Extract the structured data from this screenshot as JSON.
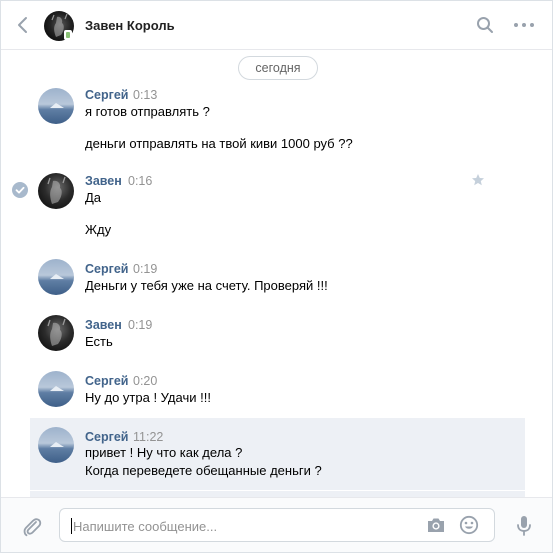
{
  "header": {
    "title": "Завен Король"
  },
  "date_divider": "сегодня",
  "messages": [
    {
      "author": "Сергей",
      "time": "0:13",
      "lines": [
        "я готов отправлять ?",
        "деньги отправлять на твой киви 1000 руб ??"
      ]
    },
    {
      "author": "Завен",
      "time": "0:16",
      "lines": [
        "Да",
        "Жду"
      ]
    },
    {
      "author": "Сергей",
      "time": "0:19",
      "lines": [
        "Деньги у тебя уже на счету. Проверяй !!!"
      ]
    },
    {
      "author": "Завен",
      "time": "0:19",
      "lines": [
        "Есть"
      ]
    },
    {
      "author": "Сергей",
      "time": "0:20",
      "lines": [
        "Ну до утра ! Удачи !!!"
      ]
    },
    {
      "author": "Сергей",
      "time": "11:22",
      "lines": [
        "привет ! Ну что как дела ?",
        "Когда переведете обещанные деньги ?"
      ]
    }
  ],
  "composer": {
    "placeholder": "Напишите сообщение..."
  },
  "colors": {
    "author": "#42648b",
    "time": "#939393",
    "highlight": "#edf0f5",
    "icon": "#99a2ad",
    "online": "#8ac176"
  },
  "icons": {
    "back": "chevron-left-icon",
    "search": "search-icon",
    "more": "more-horizontal-icon",
    "read": "check-circle-icon",
    "favorite": "star-icon",
    "attach": "paperclip-icon",
    "camera": "camera-icon",
    "smile": "smile-icon",
    "mic": "microphone-icon"
  }
}
